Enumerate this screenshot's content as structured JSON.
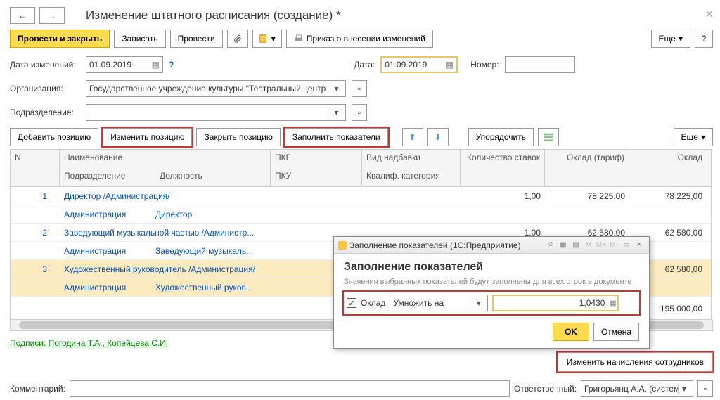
{
  "title": "Изменение штатного расписания (создание) *",
  "toolbar": {
    "post_close": "Провести и закрыть",
    "save": "Записать",
    "post": "Провести",
    "prikaz": "Приказ о внесении изменений",
    "more": "Еще"
  },
  "form": {
    "date_change_label": "Дата изменений:",
    "date_change": "01.09.2019",
    "date_label": "Дата:",
    "date": "01.09.2019",
    "number_label": "Номер:",
    "number": "",
    "org_label": "Организация:",
    "org": "Государственное учреждение культуры \"Театральный центр",
    "dept_label": "Подразделение:",
    "dept": ""
  },
  "table_tb": {
    "add": "Добавить позицию",
    "change": "Изменить позицию",
    "close": "Закрыть позицию",
    "fill": "Заполнить показатели",
    "order": "Упорядочить",
    "more": "Еще"
  },
  "columns": {
    "n": "N",
    "name": "Наименование",
    "dept": "Подразделение",
    "pos": "Должность",
    "pkg": "ПКГ",
    "pku": "ПКУ",
    "vid": "Вид надбавки",
    "kval": "Квалиф. категория",
    "kol": "Количество ставок",
    "okt": "Оклад (тариф)",
    "okl": "Оклад"
  },
  "rows": [
    {
      "n": "1",
      "name": "Директор /Администрация/",
      "dept": "Администрация",
      "pos": "Директор",
      "kol": "1,00",
      "okt": "78 225,00",
      "okl": "78 225,00"
    },
    {
      "n": "2",
      "name": "Заведующий музыкальной частью /Администр...",
      "dept": "Администрация",
      "pos": "Заведующий музыкаль...",
      "kol": "1,00",
      "okt": "62 580,00",
      "okl": "62 580,00"
    },
    {
      "n": "3",
      "name": "Художественный руководитель /Администрация/",
      "dept": "Администрация",
      "pos": "Художественный руков...",
      "kol": "",
      "okt": "",
      "okl": "62 580,00"
    }
  ],
  "total": "195 000,00",
  "sign_link": "Подписи: Погодина Т.А., Копейцева С.И.",
  "change_emp": "Изменить начисления сотрудников",
  "footer": {
    "comment_label": "Комментарий:",
    "resp_label": "Ответственный:",
    "resp": "Григорьянц А.А. (системн"
  },
  "modal": {
    "title": "Заполнение показателей  (1С:Предприятие)",
    "header": "Заполнение показателей",
    "desc": "Значения выбранных показателей будут заполнены для всех строк в документе",
    "field": "Оклад",
    "op": "Умножить на",
    "value": "1,0430",
    "ok": "OK",
    "cancel": "Отмена"
  }
}
